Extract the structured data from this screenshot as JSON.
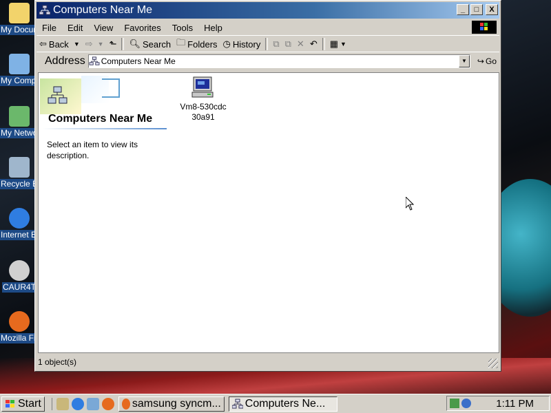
{
  "desktop": {
    "icons": [
      {
        "label": "My Documents",
        "icon": "folder-icon",
        "color": "#f2d36b"
      },
      {
        "label": "My Computer",
        "icon": "computer-icon",
        "color": "#7fb2e5"
      },
      {
        "label": "My Network Places",
        "icon": "network-icon",
        "color": "#6bb86b"
      },
      {
        "label": "Recycle Bin",
        "icon": "recycle-bin-icon",
        "color": "#9fb6cc"
      },
      {
        "label": "Internet Explorer",
        "icon": "ie-icon",
        "color": "#2f7de1"
      },
      {
        "label": "CAUR4T",
        "icon": "cd-icon",
        "color": "#d0d0d0"
      },
      {
        "label": "Mozilla Firefox",
        "icon": "firefox-icon",
        "color": "#e66a1e"
      }
    ]
  },
  "window": {
    "title": "Computers Near Me",
    "buttons": {
      "minimize": "_",
      "maximize": "□",
      "close": "X"
    }
  },
  "menubar": [
    "File",
    "Edit",
    "View",
    "Favorites",
    "Tools",
    "Help"
  ],
  "toolbar": {
    "back": "Back",
    "search": "Search",
    "folders": "Folders",
    "history": "History"
  },
  "address": {
    "label": "Address",
    "value": "Computers Near Me",
    "go": "Go"
  },
  "content": {
    "banner_title": "Computers Near Me",
    "description": "Select an item to view its description.",
    "items": [
      {
        "name": "Vm8-530cdc30a91",
        "line1": "Vm8-530cdc",
        "line2": "30a91"
      }
    ]
  },
  "status": {
    "text": "1 object(s)"
  },
  "taskbar": {
    "start": "Start",
    "tasks": [
      {
        "label": "samsung syncm...",
        "active": false
      },
      {
        "label": "Computers Ne...",
        "active": true
      }
    ],
    "clock": "1:11 PM"
  },
  "colors": {
    "titlebar_start": "#0a246a",
    "titlebar_end": "#a6caf0",
    "face": "#d4d0c8",
    "desktop_label_bg": "#1d4a86"
  }
}
